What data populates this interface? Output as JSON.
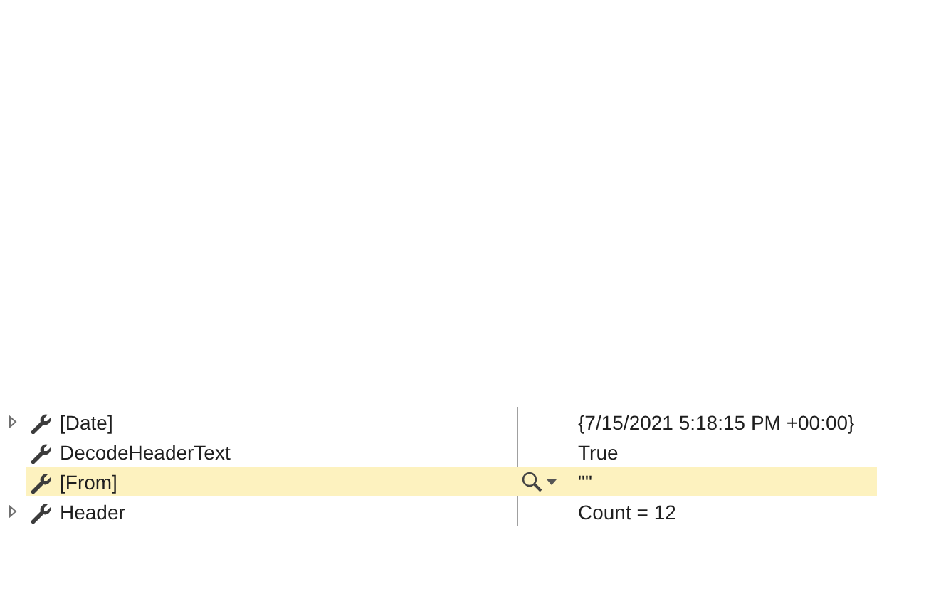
{
  "properties": [
    {
      "name": "[Date]",
      "value": "{7/15/2021 5:18:15 PM +00:00}",
      "expandable": true,
      "selected": false
    },
    {
      "name": "DecodeHeaderText",
      "value": "True",
      "expandable": false,
      "selected": false
    },
    {
      "name": "[From]",
      "value": "\"\"",
      "expandable": false,
      "selected": true
    },
    {
      "name": "Header",
      "value": "Count = 12",
      "expandable": true,
      "selected": false
    }
  ]
}
